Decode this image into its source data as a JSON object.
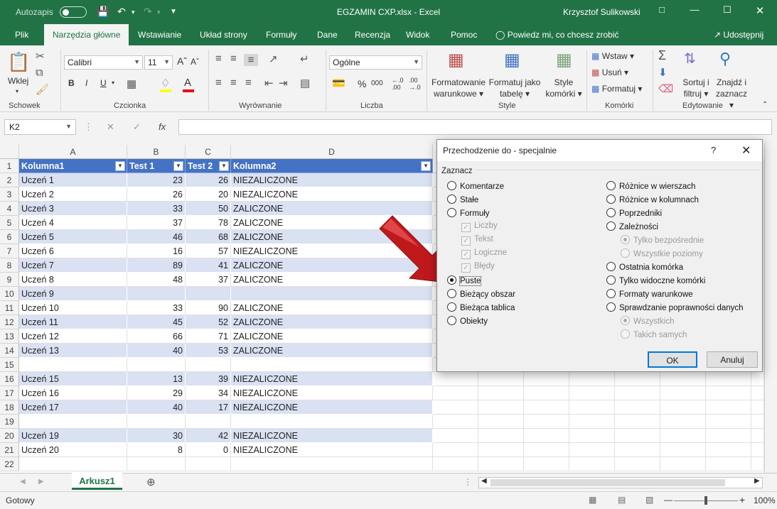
{
  "title": {
    "autosave_label": "Autozapis",
    "window_title": "EGZAMIN CXP.xlsx  -  Excel",
    "user": "Krzysztof Sulikowski"
  },
  "tabs": [
    "Plik",
    "Narzędzia główne",
    "Wstawianie",
    "Układ strony",
    "Formuły",
    "Dane",
    "Recenzja",
    "Widok",
    "Pomoc"
  ],
  "tell_me": "Powiedz mi, co chcesz zrobić",
  "share": "Udostępnij",
  "ribbon": {
    "paste": "Wklej",
    "font_name": "Calibri",
    "font_size": "11",
    "bold": "B",
    "italic": "I",
    "underline": "U",
    "number_format": "Ogólne",
    "percent": "%",
    "thousands": "000",
    "cond_format": [
      "Formatowanie",
      "warunkowe"
    ],
    "format_table": [
      "Formatuj jako",
      "tabelę"
    ],
    "cell_styles": [
      "Style",
      "komórki"
    ],
    "insert": "Wstaw",
    "delete": "Usuń",
    "format": "Formatuj",
    "sort": [
      "Sortuj i",
      "filtruj"
    ],
    "find": [
      "Znajdź i",
      "zaznacz"
    ],
    "groups": [
      "Schowek",
      "Czcionka",
      "Wyrównanie",
      "Liczba",
      "Style",
      "Komórki",
      "Edytowanie"
    ]
  },
  "formula_bar": {
    "name_box": "K2",
    "fx": "fx",
    "formula": ""
  },
  "columns": [
    "A",
    "B",
    "C",
    "D"
  ],
  "table": {
    "headers": [
      "Kolumna1",
      "Test 1",
      "Test 2",
      "Kolumna2"
    ],
    "rows": [
      [
        "Uczeń 1",
        "23",
        "26",
        "NIEZALICZONE"
      ],
      [
        "Uczeń 2",
        "26",
        "20",
        "NIEZALICZONE"
      ],
      [
        "Uczeń 3",
        "33",
        "50",
        "ZALICZONE"
      ],
      [
        "Uczeń 4",
        "37",
        "78",
        "ZALICZONE"
      ],
      [
        "Uczeń 5",
        "46",
        "68",
        "ZALICZONE"
      ],
      [
        "Uczeń 6",
        "16",
        "57",
        "NIEZALICZONE"
      ],
      [
        "Uczeń 7",
        "89",
        "41",
        "ZALICZONE"
      ],
      [
        "Uczeń 8",
        "48",
        "37",
        "ZALICZONE"
      ],
      [
        "Uczeń 9",
        "",
        "",
        ""
      ],
      [
        "Uczeń 10",
        "33",
        "90",
        "ZALICZONE"
      ],
      [
        "Uczeń 11",
        "45",
        "52",
        "ZALICZONE"
      ],
      [
        "Uczeń 12",
        "66",
        "71",
        "ZALICZONE"
      ],
      [
        "Uczeń 13",
        "40",
        "53",
        "ZALICZONE"
      ],
      [
        "",
        "",
        "",
        ""
      ],
      [
        "Uczeń 15",
        "13",
        "39",
        "NIEZALICZONE"
      ],
      [
        "Uczeń 16",
        "29",
        "34",
        "NIEZALICZONE"
      ],
      [
        "Uczeń 17",
        "40",
        "17",
        "NIEZALICZONE"
      ],
      [
        "",
        "",
        "",
        ""
      ],
      [
        "Uczeń 19",
        "30",
        "42",
        "NIEZALICZONE"
      ],
      [
        "Uczeń 20",
        "8",
        "0",
        "NIEZALICZONE"
      ],
      [
        "",
        "",
        "",
        ""
      ]
    ]
  },
  "sheet_tab": "Arkusz1",
  "status": {
    "ready": "Gotowy",
    "zoom": "100%"
  },
  "dialog": {
    "title": "Przechodzenie do - specjalnie",
    "help": "?",
    "group_label": "Zaznacz",
    "left_options": [
      {
        "label": "Komentarze",
        "kind": "radio",
        "checked": false,
        "disabled": false
      },
      {
        "label": "Stałe",
        "kind": "radio",
        "checked": false,
        "disabled": false
      },
      {
        "label": "Formuły",
        "kind": "radio",
        "checked": false,
        "disabled": false
      },
      {
        "label": "Liczby",
        "kind": "check",
        "checked": true,
        "disabled": true
      },
      {
        "label": "Tekst",
        "kind": "check",
        "checked": true,
        "disabled": true
      },
      {
        "label": "Logiczne",
        "kind": "check",
        "checked": true,
        "disabled": true
      },
      {
        "label": "Błędy",
        "kind": "check",
        "checked": true,
        "disabled": true
      },
      {
        "label": "Puste",
        "kind": "radio",
        "checked": true,
        "disabled": false
      },
      {
        "label": "Bieżący obszar",
        "kind": "radio",
        "checked": false,
        "disabled": false
      },
      {
        "label": "Bieżąca tablica",
        "kind": "radio",
        "checked": false,
        "disabled": false
      },
      {
        "label": "Obiekty",
        "kind": "radio",
        "checked": false,
        "disabled": false
      }
    ],
    "right_options": [
      {
        "label": "Różnice w wierszach",
        "kind": "radio",
        "checked": false,
        "disabled": false
      },
      {
        "label": "Różnice w kolumnach",
        "kind": "radio",
        "checked": false,
        "disabled": false
      },
      {
        "label": "Poprzedniki",
        "kind": "radio",
        "checked": false,
        "disabled": false
      },
      {
        "label": "Zależności",
        "kind": "radio",
        "checked": false,
        "disabled": false
      },
      {
        "label": "Tylko bezpośrednie",
        "kind": "radio",
        "checked": true,
        "disabled": true
      },
      {
        "label": "Wszystkie poziomy",
        "kind": "radio",
        "checked": false,
        "disabled": true
      },
      {
        "label": "Ostatnia komórka",
        "kind": "radio",
        "checked": false,
        "disabled": false
      },
      {
        "label": "Tylko widoczne komórki",
        "kind": "radio",
        "checked": false,
        "disabled": false
      },
      {
        "label": "Formaty warunkowe",
        "kind": "radio",
        "checked": false,
        "disabled": false
      },
      {
        "label": "Sprawdzanie poprawności danych",
        "kind": "radio",
        "checked": false,
        "disabled": false
      },
      {
        "label": "Wszystkich",
        "kind": "radio",
        "checked": true,
        "disabled": true
      },
      {
        "label": "Takich samych",
        "kind": "radio",
        "checked": false,
        "disabled": true
      }
    ],
    "ok": "OK",
    "cancel": "Anuluj"
  },
  "colors": {
    "excel_green": "#217346",
    "table_header": "#4472c4",
    "band": "#d9e1f2",
    "arrow": "#c0191c"
  }
}
